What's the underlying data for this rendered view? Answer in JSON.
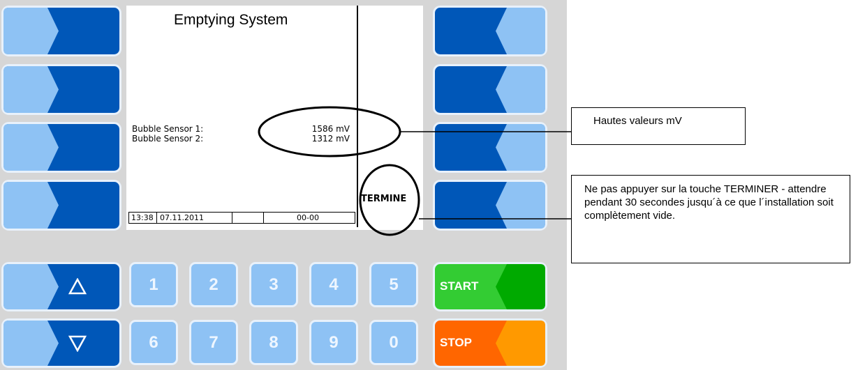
{
  "screen": {
    "title": "Emptying System",
    "sensors": [
      {
        "label": "Bubble Sensor 1:",
        "value": "1586 mV"
      },
      {
        "label": "Bubble Sensor 2:",
        "value": "1312 mV"
      }
    ],
    "softkey_label": "TERMINE",
    "status": {
      "time": "13:38",
      "date": "07.11.2011",
      "code": "00-00"
    }
  },
  "keypad": {
    "digits_row1": [
      "1",
      "2",
      "3",
      "4",
      "5"
    ],
    "digits_row2": [
      "6",
      "7",
      "8",
      "9",
      "0"
    ],
    "start_label": "START",
    "stop_label": "STOP",
    "up_icon": "up-triangle-icon",
    "down_icon": "down-triangle-icon"
  },
  "callouts": {
    "high_values": "Hautes valeurs mV",
    "warning": "Ne pas appuyer sur la touche TERMINER - attendre pendant 30 secondes  jusqu´à ce que l´installation soit complètement vide."
  },
  "colors": {
    "key_dark": "#0057b8",
    "key_light": "#8ec2f4",
    "start_green": "#33cc33",
    "stop_orange": "#ff6600",
    "panel_gray": "#d6d6d6"
  }
}
